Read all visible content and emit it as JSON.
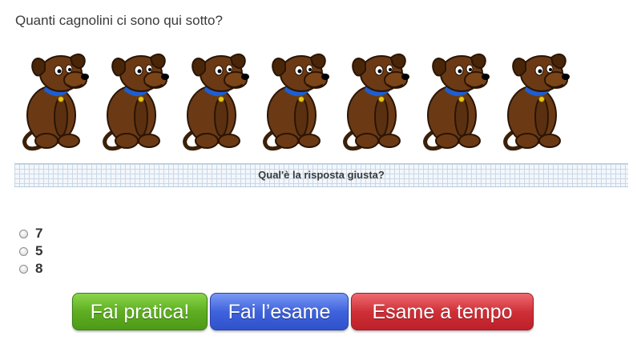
{
  "question": "Quanti cagnolini ci sono qui sotto?",
  "dogs": {
    "count": 7,
    "icon": "dog-icon"
  },
  "prompt": "Qual'è la risposta giusta?",
  "options": [
    {
      "label": "7",
      "selected": false
    },
    {
      "label": "5",
      "selected": false
    },
    {
      "label": "8",
      "selected": false
    }
  ],
  "buttons": {
    "practice": {
      "label": "Fai pratica!",
      "color": "#5fae22"
    },
    "exam": {
      "label": "Fai l’esame",
      "color": "#3f63dc"
    },
    "timed": {
      "label": "Esame a tempo",
      "color": "#cf3038"
    }
  }
}
